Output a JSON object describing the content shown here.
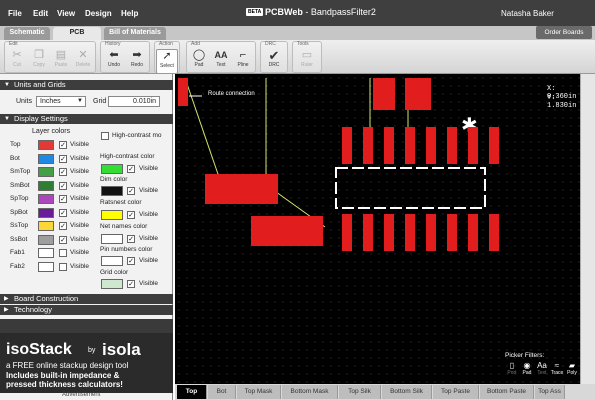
{
  "menubar": {
    "items": [
      "File",
      "Edit",
      "View",
      "Design",
      "Help"
    ],
    "beta": "BETA",
    "app_name": "PCBWeb",
    "doc_title": "BandpassFilter2",
    "separator": " - ",
    "user": "Natasha Baker"
  },
  "tabs": {
    "items": [
      "Schematic",
      "PCB",
      "Bill of Materials"
    ],
    "active": "PCB",
    "order_button": "Order Boards"
  },
  "toolbar": {
    "groups": {
      "edit": "Edit",
      "history": "History",
      "action": "Action",
      "add": "Add",
      "drc": "DRC",
      "tools": "Tools"
    },
    "cut": "Cut",
    "copy": "Copy",
    "paste": "Paste",
    "delete": "Delete",
    "undo": "Undo",
    "redo": "Redo",
    "select": "Select",
    "pad": "Pad",
    "text": "Text",
    "pline": "Pline",
    "drc": "DRC",
    "ruler": "Ruler"
  },
  "panel": {
    "units_grids": "Units and Grids",
    "units_label": "Units",
    "units_value": "Inches",
    "grid_label": "Grid",
    "grid_value": "0.010in",
    "display_settings": "Display Settings",
    "layer_colors": "Layer colors",
    "visible": "Visible",
    "layers": [
      {
        "name": "Top",
        "color": "#e53935",
        "visible": true
      },
      {
        "name": "Bot",
        "color": "#1e88e5",
        "visible": true
      },
      {
        "name": "SmTop",
        "color": "#43a047",
        "visible": true
      },
      {
        "name": "SmBot",
        "color": "#2e7d32",
        "visible": true
      },
      {
        "name": "SpTop",
        "color": "#ab47bc",
        "visible": true
      },
      {
        "name": "SpBot",
        "color": "#6a1b9a",
        "visible": true
      },
      {
        "name": "SsTop",
        "color": "#fdd835",
        "visible": true
      },
      {
        "name": "SsBot",
        "color": "#9e9e9e",
        "visible": true
      },
      {
        "name": "Fab1",
        "color": "#ffffff",
        "visible": false
      },
      {
        "name": "Fab2",
        "color": "#ffffff",
        "visible": false
      }
    ],
    "high_contrast_mode": "High-contrast mo",
    "high_contrast_color": "High-contrast color",
    "high_contrast_swatch": "#33dd33",
    "dim_color": "Dim color",
    "dim_swatch": "#111111",
    "ratsnest_color": "Ratsnest color",
    "ratsnest_swatch": "#ffff00",
    "net_names_color": "Net names color",
    "net_names_swatch": "#ffffff",
    "pin_numbers_color": "Pin numbers color",
    "pin_numbers_swatch": "#ffffff",
    "grid_color": "Grid color",
    "grid_swatch": "#cfe6cf",
    "board_construction": "Board Construction",
    "technology": "Technology",
    "ad": {
      "brand1": "isoStack",
      "by": "by",
      "brand2": "isola",
      "line1": "a FREE online stackup design tool",
      "line2": "Includes built-in impedance &",
      "line3": "pressed thickness calculators!",
      "footer": "Advertisement"
    }
  },
  "canvas": {
    "route_label": "Route connection",
    "x_readout": "X: 0.360in",
    "y_readout": "Y: 1.830in",
    "picker_title": "Picker Filters:",
    "picker": [
      "Port",
      "Pad",
      "Text",
      "Trace",
      "Poly"
    ]
  },
  "layer_tabs": [
    "Top",
    "Bot",
    "Top Mask",
    "Bottom Mask",
    "Top Silk",
    "Bottom Silk",
    "Top Paste",
    "Bottom Paste",
    "Top Ass"
  ],
  "active_layer": "Top"
}
